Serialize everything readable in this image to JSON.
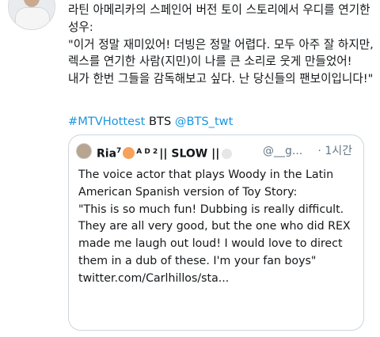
{
  "tweet": {
    "text": "라틴 아메리카의 스페인어 버전 토이 스토리에서 우디를 연기한 성우:\n\"이거 정말 재미있어! 더빙은 정말 어렵다. 모두 아주 잘 하지만, 렉스를 연기한 사람(지민)이 나를 큰 소리로 웃게 만들었어! 내가 한번 그들을 감독해보고 싶다. 난 당신들의 팬보이입니다!\"",
    "hashtag": "#MTVHottest",
    "plain": "BTS",
    "mention": "@BTS_twt"
  },
  "quote": {
    "name": "Ria",
    "name_sup": "7",
    "name_suffix": "|| SLOW ||",
    "badge": "A D 2",
    "handle": "@__g...",
    "time": "· 1시간",
    "text": "The voice actor that plays Woody in the Latin American Spanish version of Toy Story:\n\"This is so much fun! Dubbing is really difficult. They are all very good, but the one who did REX made me laugh out loud! I would love to direct them in a dub of these. I'm your fan boys\"",
    "link": "twitter.com/Carlhillos/sta..."
  },
  "colors": {
    "link": "#1b95e0",
    "muted": "#657786",
    "border": "#ccd6dd"
  },
  "icons": [
    "peach-emoji",
    "gray-circle-emoji"
  ]
}
